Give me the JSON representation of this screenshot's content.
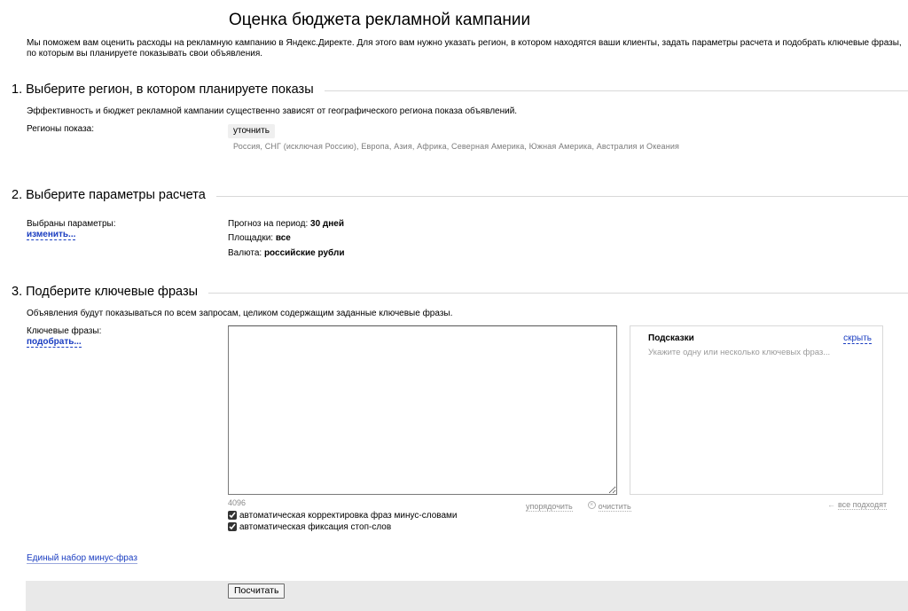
{
  "page": {
    "title": "Оценка бюджета рекламной кампании",
    "intro": "Мы поможем вам оценить расходы на рекламную кампанию в Яндекс.Директе. Для этого вам нужно указать регион, в котором находятся ваши клиенты, задать параметры расчета и подобрать ключевые фразы, по которым вы планируете показывать свои объявления."
  },
  "section1": {
    "heading": "1. Выберите регион, в котором планируете показы",
    "description": "Эффективность и бюджет рекламной кампании существенно зависят от географического региона показа объявлений.",
    "regions_label": "Регионы показа:",
    "refine_button": "уточнить",
    "regions_value": "Россия, СНГ (исключая Россию), Европа, Азия, Африка, Северная Америка, Южная Америка, Австралия и Океания"
  },
  "section2": {
    "heading": "2. Выберите параметры расчета",
    "params_label": "Выбраны параметры:",
    "change_link": "изменить...",
    "period_label": "Прогноз на период:",
    "period_value": "30 дней",
    "sites_label": "Площадки:",
    "sites_value": "все",
    "currency_label": "Валюта:",
    "currency_value": "российские рубли"
  },
  "section3": {
    "heading": "3. Подберите ключевые фразы",
    "description": "Объявления будут показываться по всем запросам, целиком содержащим заданные ключевые фразы.",
    "keywords_label": "Ключевые фразы:",
    "pick_link": "подобрать...",
    "keywords_value": "",
    "counter": "4096",
    "sort_link": "упорядочить",
    "clear_link": "очистить",
    "hints": {
      "title": "Подсказки",
      "hide_link": "скрыть",
      "placeholder": "Укажите одну или несколько ключевых фраз..."
    },
    "all_fit_link": "все подходят",
    "checkbox_minus_words": "автоматическая корректировка фраз минус-словами",
    "checkbox_stop_words": "автоматическая фиксация стоп-слов"
  },
  "footer": {
    "minus_phrases_link": "Единый набор минус-фраз",
    "calculate_button": "Посчитать"
  }
}
